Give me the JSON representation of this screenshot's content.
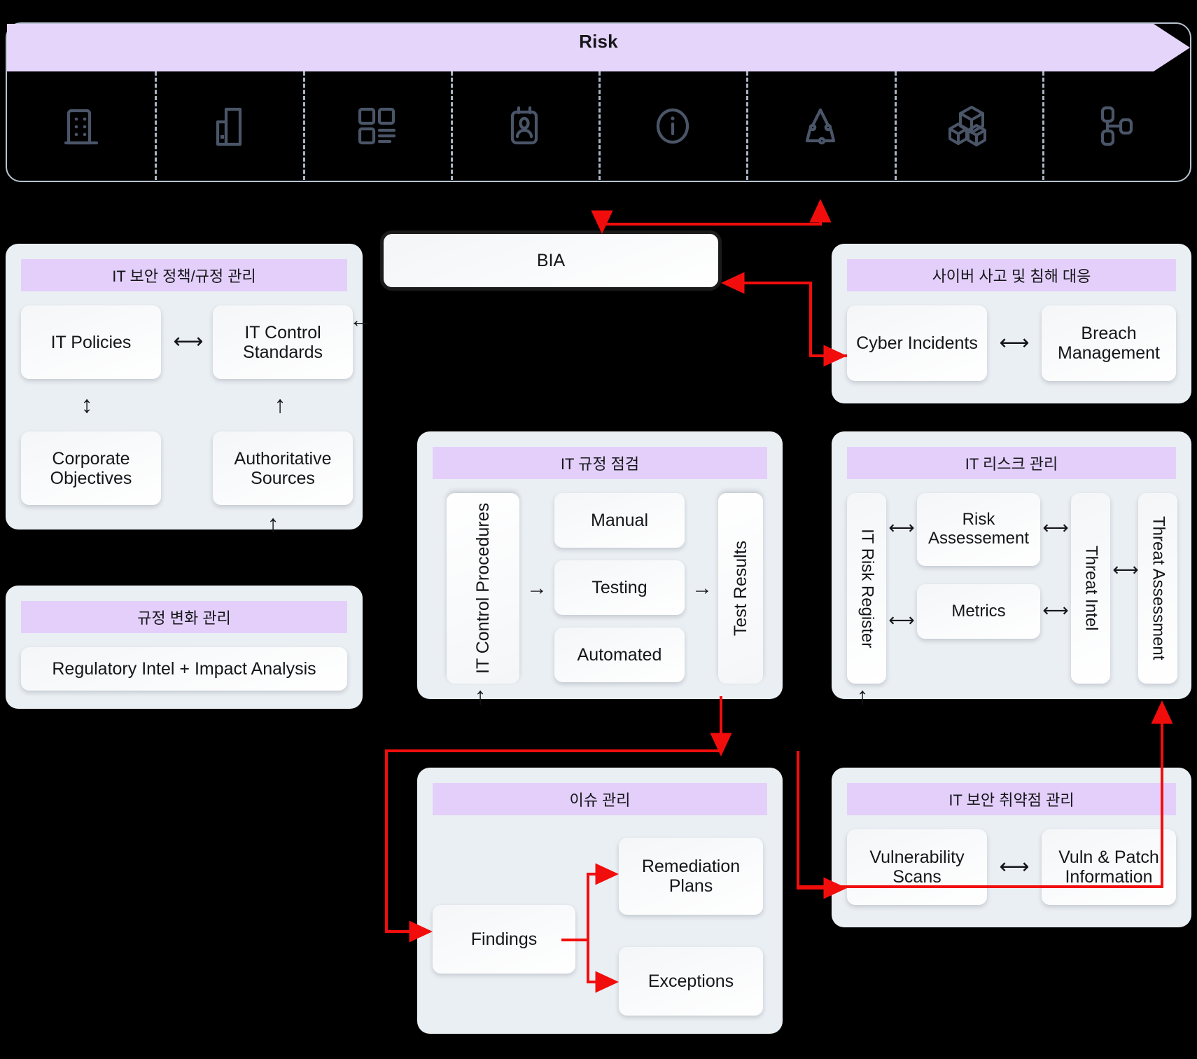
{
  "banner": {
    "title": "Risk",
    "fill": "#e6d5fb",
    "stroke": "#b9c3d0"
  },
  "icons": [
    {
      "name": "building-icon",
      "label": "Building"
    },
    {
      "name": "buildings-icon",
      "label": "Buildings"
    },
    {
      "name": "dashboard-grid-icon",
      "label": "Dashboard"
    },
    {
      "name": "id-badge-icon",
      "label": "Identity"
    },
    {
      "name": "info-circle-icon",
      "label": "Information"
    },
    {
      "name": "recycle-cycle-icon",
      "label": "Lifecycle"
    },
    {
      "name": "cubes-stack-icon",
      "label": "Assets"
    },
    {
      "name": "node-network-icon",
      "label": "Topology"
    }
  ],
  "colors": {
    "panel_bg": "#eaeff3",
    "title_bg": "#e3cffa",
    "card_bg": "#ffffff",
    "accent_red": "#f20d0d",
    "ink": "#15161a",
    "icon_stroke": "#4a5568",
    "divider": "#aab4c4"
  },
  "panels": {
    "policy": {
      "title": "IT 보안 정책/규정 관리",
      "cards": {
        "it_policies": "IT Policies",
        "it_control_standards": "IT Control Standards",
        "corporate_objectives": "Corporate Objectives",
        "authoritative_sources": "Authoritative Sources"
      },
      "arrows": {
        "policies_standards": "⟷",
        "policies_objectives": "↕",
        "sources_standards": "↑",
        "into_standards": "←",
        "into_sources": "↑"
      }
    },
    "regchange": {
      "title": "규정 변화 관리",
      "cards": {
        "regulatory_intel": "Regulatory Intel + Impact Analysis"
      }
    },
    "bia": {
      "label": "BIA"
    },
    "cyber": {
      "title": "사이버 사고 및 침해 대응",
      "cards": {
        "cyber_incidents": "Cyber Incidents",
        "breach_management": "Breach Management"
      },
      "arrows": {
        "incidents_breach": "⟷"
      }
    },
    "compliance": {
      "title": "IT 규정 점검",
      "cards": {
        "it_control_procedures": "IT Control Procedures",
        "manual": "Manual",
        "testing": "Testing",
        "automated": "Automated",
        "test_results": "Test Results"
      },
      "arrows": {
        "procedures_testing": "→",
        "testing_results": "→",
        "into_procedures": "↑"
      }
    },
    "itrisk": {
      "title": "IT 리스크 관리",
      "cards": {
        "it_risk_register": "IT Risk Register",
        "risk_assessment": "Risk Assessement",
        "metrics": "Metrics",
        "threat_intel": "Threat Intel",
        "threat_assessment": "Threat Assessment"
      },
      "arrows": {
        "register_assessment": "⟷",
        "register_metrics": "⟷",
        "assessment_intel": "⟷",
        "metrics_intel": "⟷",
        "intel_threatassess": "⟷",
        "into_register": "↑"
      }
    },
    "issue": {
      "title": "이슈 관리",
      "cards": {
        "findings": "Findings",
        "remediation_plans": "Remediation Plans",
        "exceptions": "Exceptions"
      }
    },
    "vuln": {
      "title": "IT 보안 취약점 관리",
      "cards": {
        "vulnerability_scans": "Vulnerability Scans",
        "vuln_patch_information": "Vuln & Patch Information"
      },
      "arrows": {
        "scans_info": "⟷"
      }
    }
  }
}
